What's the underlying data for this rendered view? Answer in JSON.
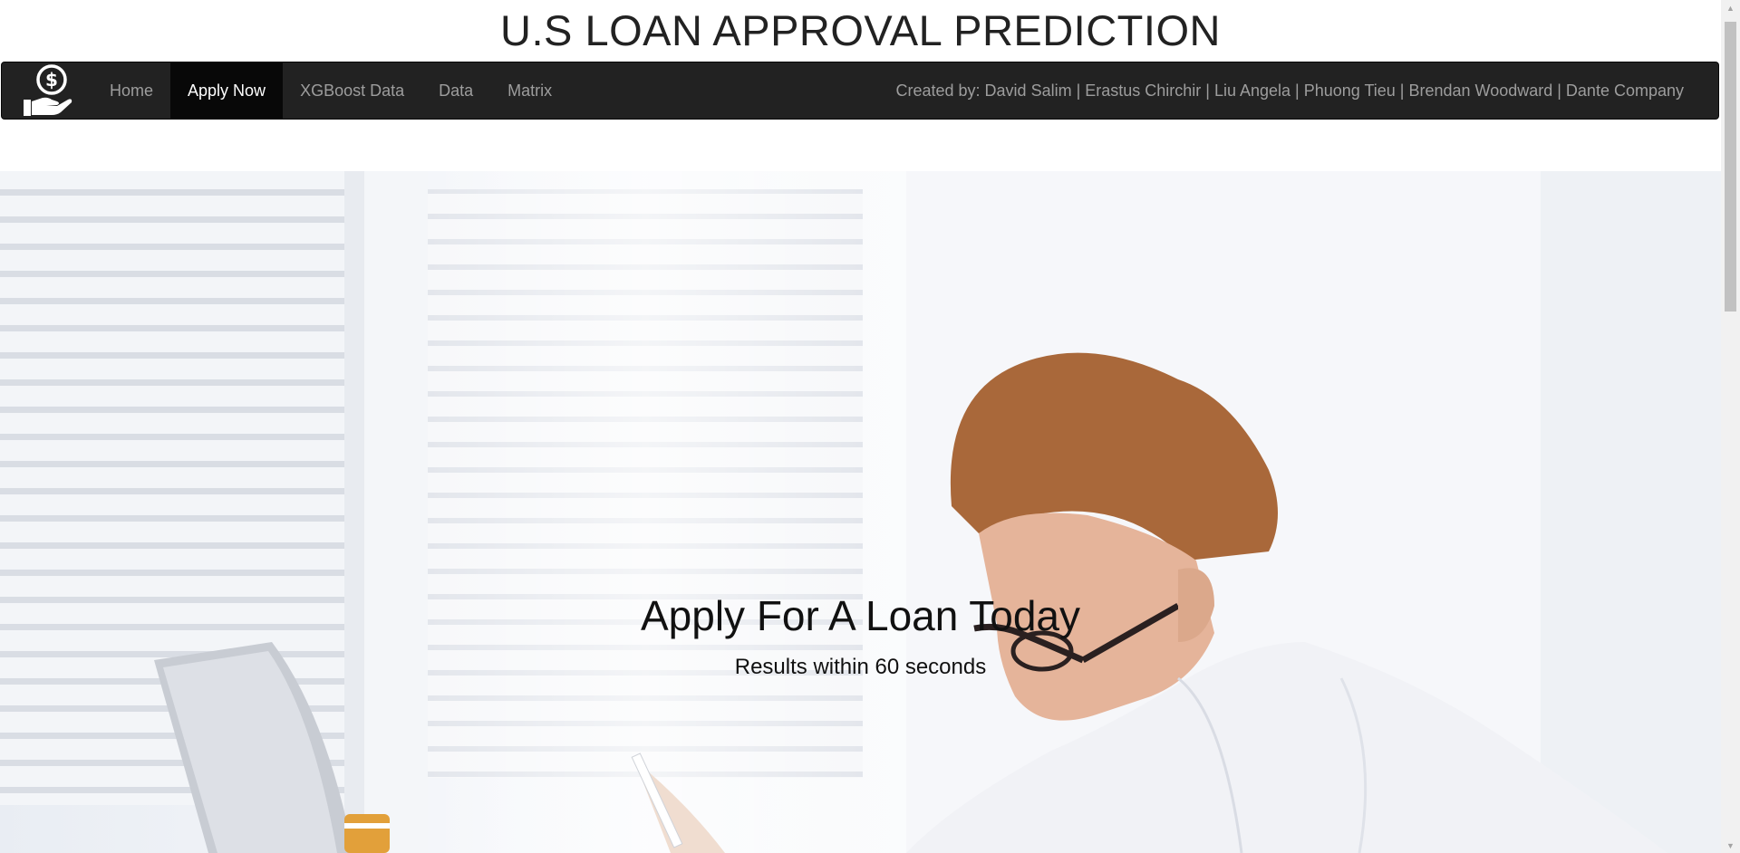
{
  "site": {
    "title": "U.S LOAN APPROVAL PREDICTION"
  },
  "nav": {
    "brand_icon": "hand-holding-dollar-icon",
    "items": [
      {
        "label": "Home",
        "active": false
      },
      {
        "label": "Apply Now",
        "active": true
      },
      {
        "label": "XGBoost Data",
        "active": false
      },
      {
        "label": "Data",
        "active": false
      },
      {
        "label": "Matrix",
        "active": false
      }
    ],
    "credits": "Created by: David Salim | Erastus Chirchir | Liu Angela | Phuong Tieu | Brendan Woodward | Dante Company"
  },
  "hero": {
    "heading": "Apply For A Loan Today",
    "subheading": "Results within 60 seconds",
    "image": "man-with-glasses-writing-at-laptop-photo"
  },
  "colors": {
    "navbar_bg": "#222222",
    "nav_active_bg": "#080808",
    "nav_text": "#9d9d9d",
    "nav_active_text": "#ffffff"
  }
}
